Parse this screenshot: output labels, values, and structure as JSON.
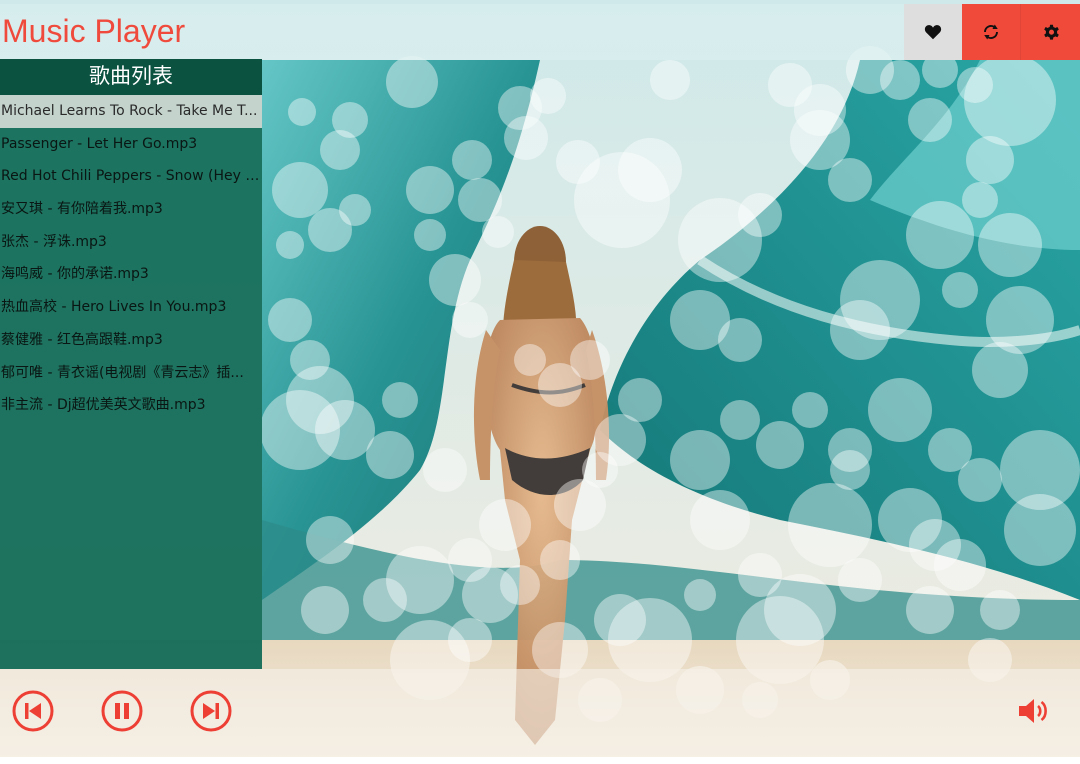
{
  "header": {
    "title": "Music Player",
    "favorite_icon": "heart-icon",
    "loop_icon": "loop-icon",
    "settings_icon": "gear-icon"
  },
  "colors": {
    "accent": "#f04a3b",
    "sidebar": "#0c6854",
    "sidebar_header": "#0a4a3a"
  },
  "sidebar": {
    "title": "歌曲列表",
    "songs": [
      {
        "label": "Michael Learns To Rock - Take Me T...",
        "active": true
      },
      {
        "label": "Passenger - Let Her Go.mp3"
      },
      {
        "label": "Red Hot Chili Peppers - Snow (Hey O..."
      },
      {
        "label": "安又琪 - 有你陪着我.mp3"
      },
      {
        "label": "张杰 - 浮诛.mp3"
      },
      {
        "label": "海鸣威 - 你的承诺.mp3"
      },
      {
        "label": "热血高校 - Hero Lives In You.mp3"
      },
      {
        "label": "蔡健雅 - 红色高跟鞋.mp3"
      },
      {
        "label": "郁可唯 - 青衣谣(电视剧《青云志》插..."
      },
      {
        "label": "非主流 - Dj超优美英文歌曲.mp3"
      }
    ]
  },
  "controls": {
    "prev_icon": "previous-icon",
    "pause_icon": "pause-icon",
    "next_icon": "next-icon",
    "volume_icon": "volume-icon"
  }
}
